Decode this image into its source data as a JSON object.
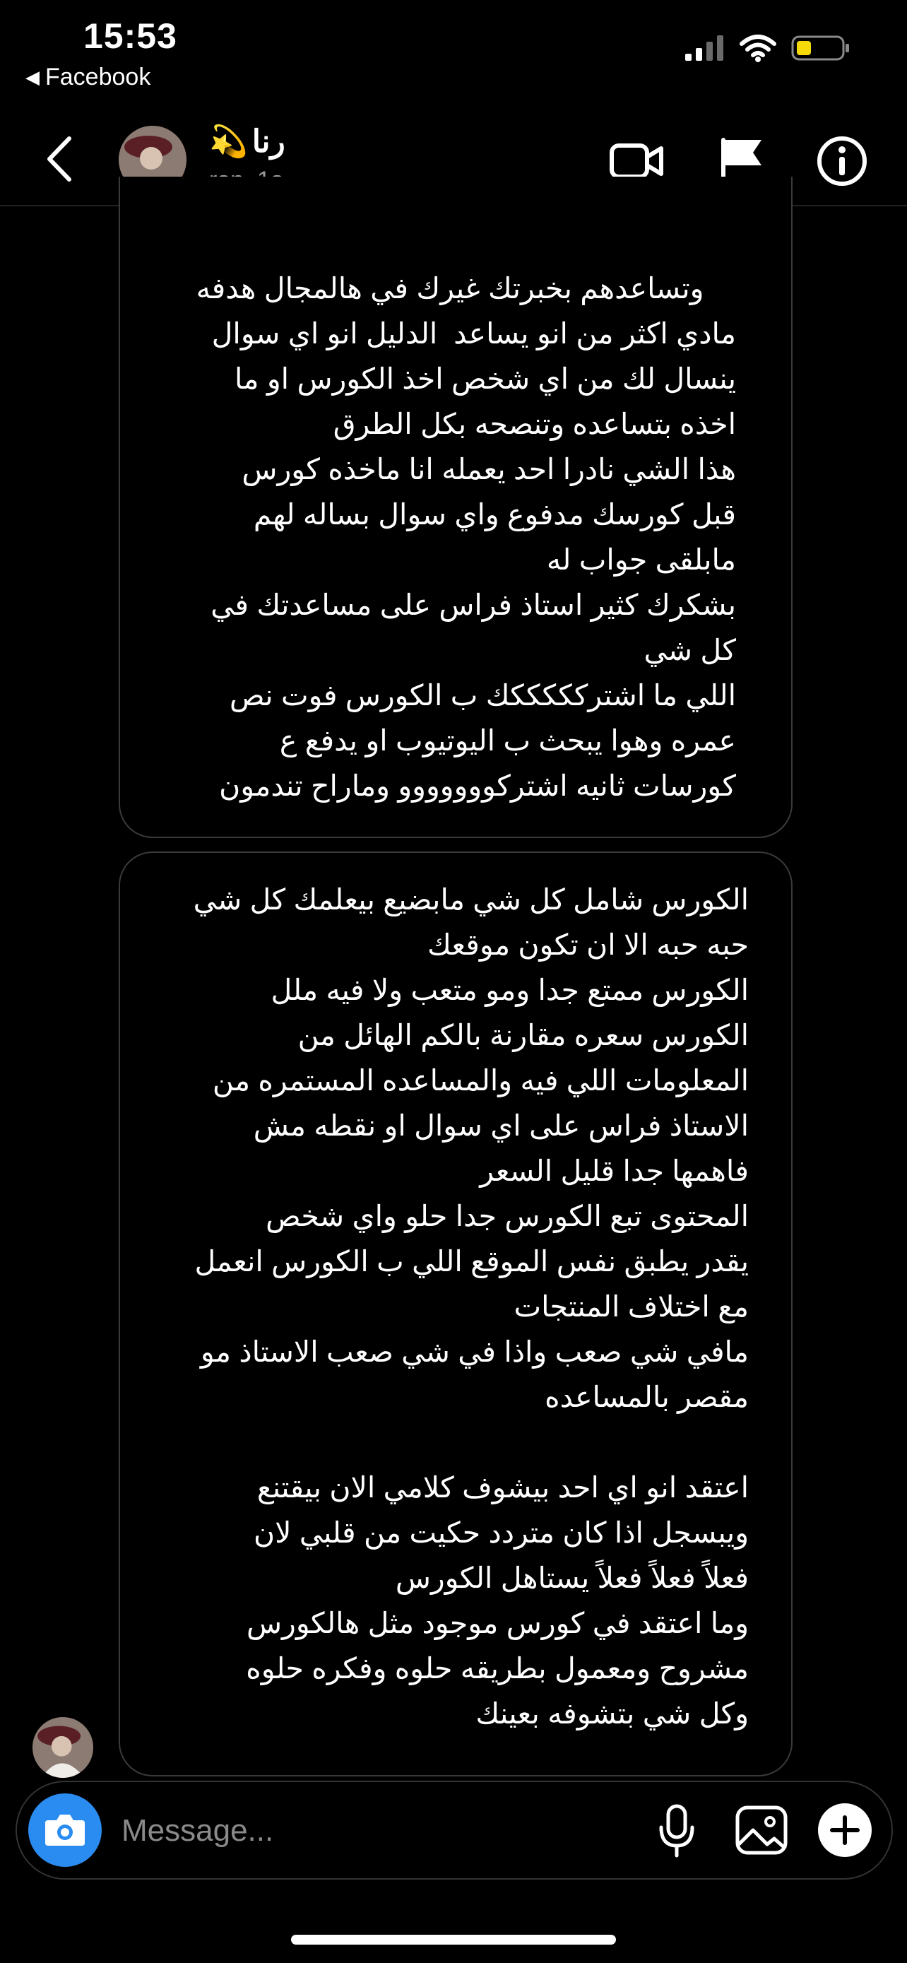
{
  "status_bar": {
    "time": "15:53",
    "back_app": "Facebook"
  },
  "header": {
    "name": "رنا",
    "name_emoji": "💫",
    "username": "ran_1a"
  },
  "messages": [
    {
      "text": "وتساعدهم بخبرتك غيرك في هالمجال هدفه\nمادي اكثر من انو يساعد  الدليل انو اي سوال\nينسال لك من اي شخص اخذ الكورس او ما\nاخذه بتساعده وتنصحه بكل الطرق\nهذا الشي نادرا احد يعمله انا ماخذه كورس\nقبل كورسك مدفوع واي سوال بساله لهم\nمابلقى جواب له\nبشكرك كثير استاذ فراس على مساعدتك في\nكل شي\nاللي ما اشتركككككك ب الكورس فوت نص\nعمره وهوا يبحث ب اليوتيوب او يدفع ع\nكورسات ثانيه اشتركووووووو وماراح تندمون",
      "emoji": "😎"
    },
    {
      "text": "الكورس شامل كل شي مابضيع بيعلمك كل شي\nحبه حبه الا ان تكون موقعك\nالكورس ممتع جدا ومو متعب ولا فيه ملل\nالكورس سعره مقارنة بالكم الهائل من\nالمعلومات اللي فيه والمساعده المستمره من\nالاستاذ فراس على اي سوال او نقطه مش\nفاهمها جدا قليل السعر\nالمحتوى تبع الكورس جدا حلو واي شخص\nيقدر يطبق نفس الموقع اللي ب الكورس انعمل\nمع اختلاف المنتجات\nمافي شي صعب واذا في شي صعب الاستاذ مو\nمقصر بالمساعده\n\nاعتقد انو اي احد بيشوف كلامي الان بيقتنع\nويبسجل اذا كان متردد حكيت من قلبي لان\nفعلاً فعلاً فعلاً يستاهل الكورس\nوما اعتقد في كورس موجود مثل هالكورس\nمشروح ومعمول بطريقه حلوه وفكره حلوه\nوكل شي بتشوفه بعينك"
    }
  ],
  "composer": {
    "placeholder": "Message..."
  },
  "icons": {
    "back": "chevron-left-icon",
    "video": "video-call-icon",
    "flag": "flag-icon",
    "info": "info-icon",
    "camera": "camera-icon",
    "mic": "microphone-icon",
    "gallery": "image-icon",
    "plus": "plus-icon"
  },
  "colors": {
    "background": "#000000",
    "bubble_border": "#3a3a3a",
    "camera_button": "#2a8cf0",
    "battery_low": "#f5d90a"
  }
}
